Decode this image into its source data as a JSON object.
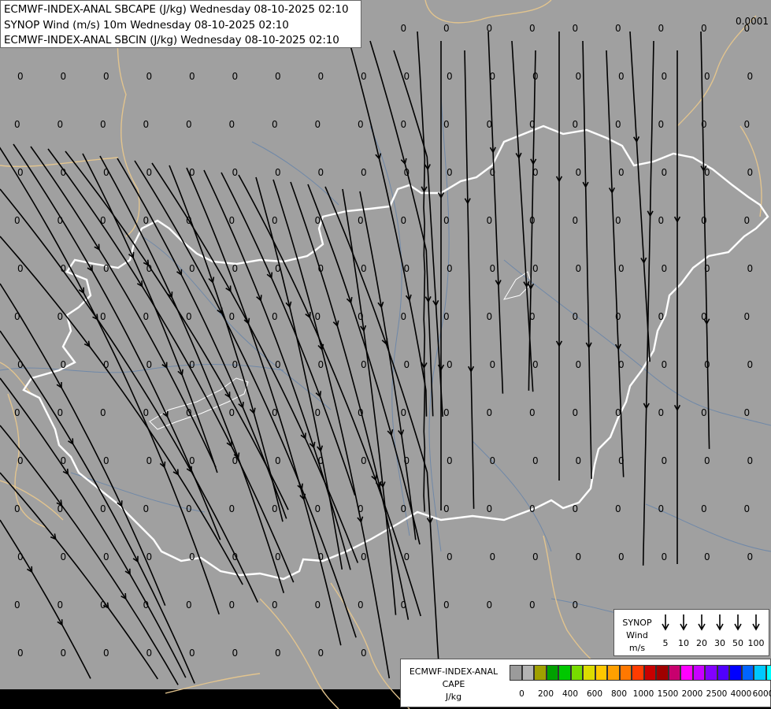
{
  "titles": {
    "line1": "ECMWF-INDEX-ANAL SBCAPE (J/kg) Wednesday 08-10-2025 02:10",
    "line2": "SYNOP Wind (m/s) 10m Wednesday 08-10-2025 02:10",
    "line3": "ECMWF-INDEX-ANAL SBCIN (J/kg) Wednesday 08-10-2025 02:10"
  },
  "corner_value": "0.0001",
  "grid_value": "0",
  "colors": {
    "background": "#a0a0a0",
    "border_country": "#ffffff",
    "border_neighbour": "#e2c48e",
    "rivers": "#6f88a8",
    "streamlines": "#000000"
  },
  "wind_legend": {
    "title_line1": "SYNOP",
    "title_line2": "Wind",
    "title_line3": "m/s",
    "values": [
      "5",
      "10",
      "20",
      "30",
      "50",
      "100"
    ]
  },
  "cape_legend": {
    "title_line1": "ECMWF-INDEX-ANAL",
    "title_line2": "CAPE",
    "title_line3": "J/kg",
    "colors": [
      "#9b9b9b",
      "#b4b4b4",
      "#a0a000",
      "#00a000",
      "#00c800",
      "#78dc00",
      "#dcdc00",
      "#ffc800",
      "#ffa000",
      "#ff7800",
      "#ff3c00",
      "#c80000",
      "#a00000",
      "#c8006e",
      "#ff00ff",
      "#c800ff",
      "#8200ff",
      "#5000ff",
      "#0000ff",
      "#0064ff",
      "#00c8ff",
      "#00ffff",
      "#ffffff"
    ],
    "labels": [
      "0",
      "200",
      "400",
      "600",
      "800",
      "1000",
      "1500",
      "2000",
      "2500",
      "4000",
      "6000"
    ]
  }
}
